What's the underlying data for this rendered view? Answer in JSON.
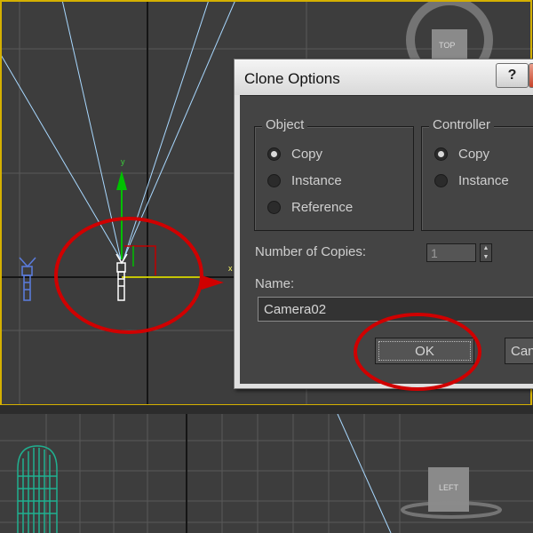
{
  "dialog": {
    "title": "Clone Options",
    "help_label": "?",
    "close_label": "✕",
    "object_group": {
      "title": "Object",
      "options": [
        "Copy",
        "Instance",
        "Reference"
      ],
      "selected": "Copy"
    },
    "controller_group": {
      "title": "Controller",
      "options": [
        "Copy",
        "Instance"
      ],
      "selected": "Copy"
    },
    "copies_label": "Number of Copies:",
    "copies_value": "1",
    "name_label": "Name:",
    "name_value": "Camera02",
    "ok_label": "OK",
    "cancel_label": "Canc"
  },
  "viewports": {
    "top_cube_label": "TOP",
    "left_cube_label": "LEFT",
    "axis_y": "y",
    "axis_x": "x"
  },
  "colors": {
    "viewport_bg": "#3d3d3d",
    "grid": "#5a5a5a",
    "active_border": "#d4b000",
    "annotation_red": "#d00000",
    "camera_lines": "#a8d8ff",
    "gizmo_green": "#00c000",
    "gizmo_yellow": "#ffff00",
    "helper_blue": "#5a7ad8",
    "cylinder_teal": "#20b090"
  }
}
